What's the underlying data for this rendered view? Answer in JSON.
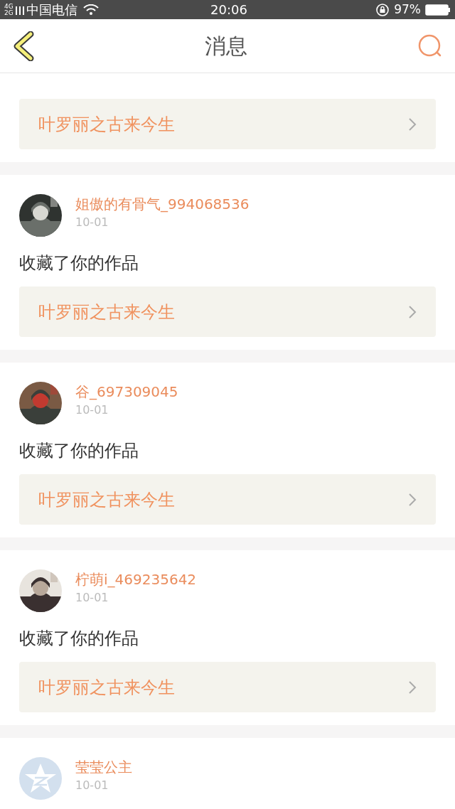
{
  "status_bar": {
    "network_types": [
      "4G",
      "2G"
    ],
    "carrier": "中国电信",
    "time": "20:06",
    "battery": "97%"
  },
  "header": {
    "title": "消息"
  },
  "top_partial": {
    "book": "叶罗丽之古来今生"
  },
  "messages": [
    {
      "user": "姐傲的有骨气_994068536",
      "date": "10-01",
      "action": "收藏了你的作品",
      "book": "叶罗丽之古来今生"
    },
    {
      "user": "谷_697309045",
      "date": "10-01",
      "action": "收藏了你的作品",
      "book": "叶罗丽之古来今生"
    },
    {
      "user": "柠萌i_469235642",
      "date": "10-01",
      "action": "收藏了你的作品",
      "book": "叶罗丽之古来今生"
    },
    {
      "avatar": {
        "kind": "default"
      },
      "user": "莹莹公主",
      "date": "10-01"
    }
  ]
}
